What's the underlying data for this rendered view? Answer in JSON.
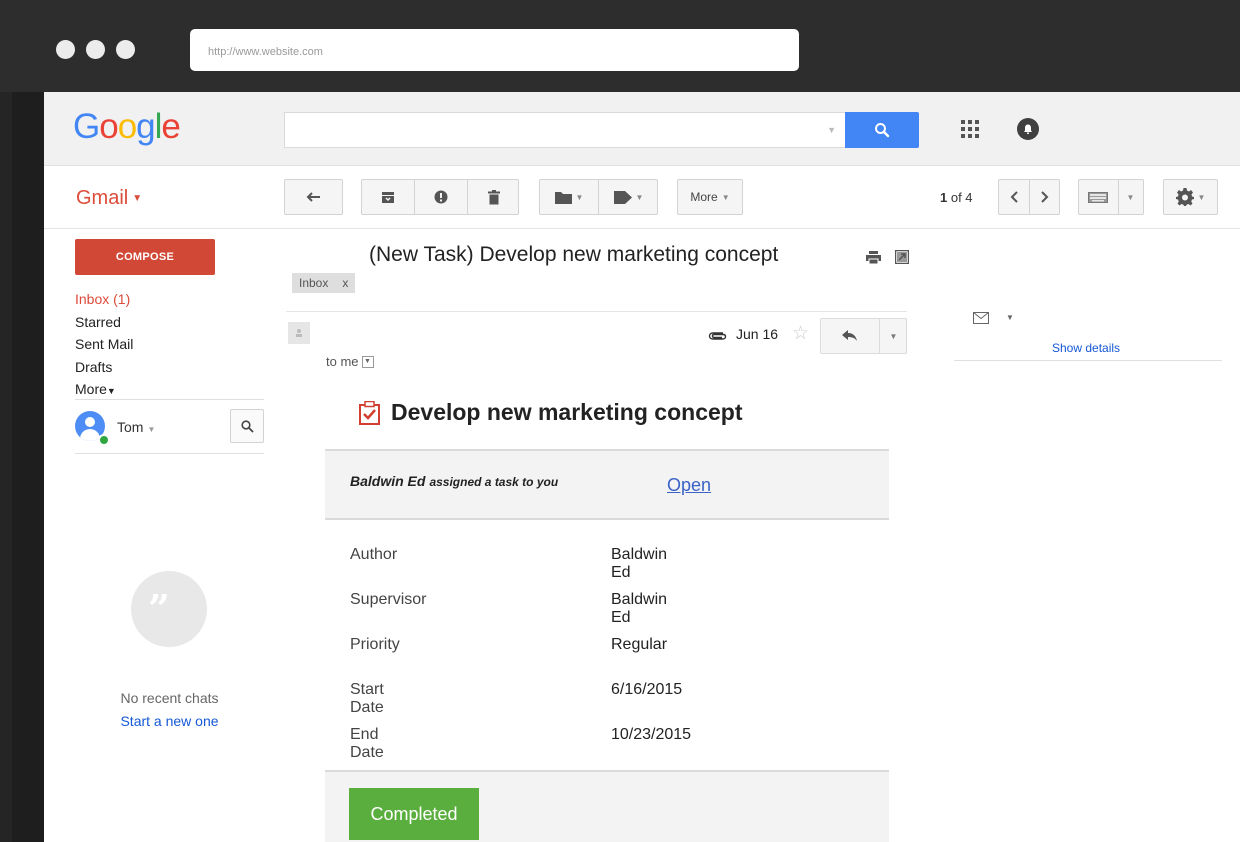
{
  "browser": {
    "url": "http://www.website.com"
  },
  "header": {
    "logo": {
      "G": "G",
      "o1": "o",
      "o2": "o",
      "g": "g",
      "l": "l",
      "e": "e"
    },
    "search_value": ""
  },
  "toolbar": {
    "gmail_label": "Gmail",
    "more_label": "More",
    "counter_current": "1",
    "counter_text": " of 4"
  },
  "sidebar": {
    "compose_label": "COMPOSE",
    "items": [
      {
        "label": "Inbox (1)"
      },
      {
        "label": "Starred"
      },
      {
        "label": "Sent Mail"
      },
      {
        "label": "Drafts"
      },
      {
        "label": "More"
      }
    ],
    "user_name": "Tom",
    "no_chats": "No recent chats",
    "start_chat": "Start a new one"
  },
  "message": {
    "subject": "(New Task) Develop new marketing concept",
    "label_chip": "Inbox",
    "label_chip_close": "x",
    "to": "to me",
    "date": "Jun 16",
    "task_title": "Develop new marketing concept",
    "assigner": "Baldwin Ed",
    "assign_text": "assigned a task to you",
    "open_link": "Open",
    "details": [
      {
        "key": "Author",
        "value": "Baldwin Ed"
      },
      {
        "key": "Supervisor",
        "value": "Baldwin Ed"
      },
      {
        "key": "Priority",
        "value": "Regular"
      },
      {
        "key": "Start Date",
        "value": "6/16/2015"
      },
      {
        "key": "End Date",
        "value": "10/23/2015"
      }
    ],
    "status_button": "Completed"
  },
  "right_panel": {
    "show_details": "Show details"
  },
  "colors": {
    "accent_blue": "#4285f4",
    "compose_red": "#d14836",
    "completed_green": "#5aae3e"
  }
}
